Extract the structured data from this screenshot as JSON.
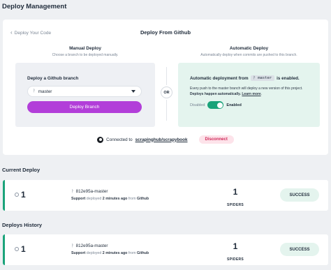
{
  "page": {
    "title": "Deploy Management"
  },
  "deploy_card": {
    "back_label": "Deploy Your Code",
    "title": "Deploy From Github",
    "manual": {
      "title": "Manual Deploy",
      "subtitle": "Choose a branch to be deployed manually.",
      "label": "Deploy a Github branch",
      "branch_value": "master",
      "deploy_button": "Deploy Branch"
    },
    "or_label": "OR",
    "automatic": {
      "title": "Automatic Deploy",
      "subtitle": "Automatically deploy when commits are pushed to this branch.",
      "line_prefix": "Automatic deployment from",
      "branch": "master",
      "line_suffix": "is enabled.",
      "desc_plain": "Every push to the master branch will deploy a new version of this project.",
      "desc_bold": "Deploys happen automatically.",
      "learn_more": "Learn more",
      "desc_end": ".",
      "toggle_off": "Disabled",
      "toggle_on": "Enabled",
      "enabled": true
    },
    "connected_prefix": "Connected to",
    "repo": "scrapinghub/scrapybook",
    "disconnect_button": "Disconnect"
  },
  "current_deploy": {
    "section_title": "Current Deploy",
    "number": "1",
    "commit": "812e95a-master",
    "user": "Support",
    "action": "deployed",
    "time": "2 minutes ago",
    "from_word": "from",
    "source": "Github",
    "spiders_count": "1",
    "spiders_label": "SPIDERS",
    "status": "SUCCESS"
  },
  "deploys_history": {
    "section_title": "Deploys History",
    "items": [
      {
        "number": "1",
        "commit": "812e95a-master",
        "user": "Support",
        "action": "deployed",
        "time": "2 minutes ago",
        "from_word": "from",
        "source": "Github",
        "spiders_count": "1",
        "spiders_label": "SPIDERS",
        "status": "SUCCESS"
      }
    ]
  },
  "colors": {
    "accent_purple": "#b23ed9",
    "success_green": "#1aa37a",
    "success_bg": "#e4f4ee",
    "disconnect_bg": "#fde3ea",
    "disconnect_text": "#d02a5a"
  }
}
